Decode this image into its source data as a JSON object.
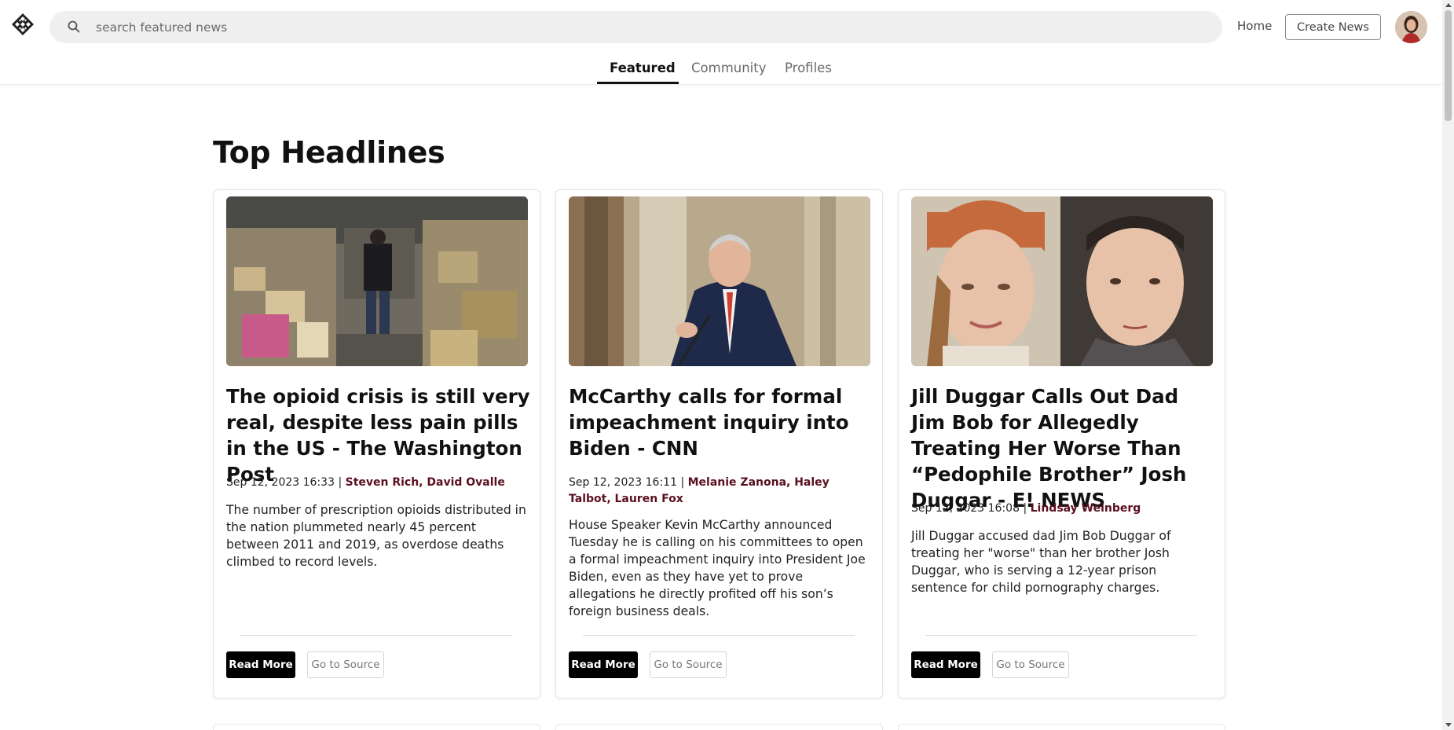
{
  "header": {
    "logo_icon": "diamond-lattice-logo-icon",
    "search_placeholder": "search featured news",
    "search_icon": "search-icon",
    "home_label": "Home",
    "create_label": "Create News"
  },
  "tabs": [
    {
      "label": "Featured",
      "active": true
    },
    {
      "label": "Community",
      "active": false
    },
    {
      "label": "Profiles",
      "active": false
    }
  ],
  "section_title": "Top Headlines",
  "articles": [
    {
      "title": "The opioid crisis is still very real, despite less pain pills in the US - The Washington Post",
      "date": "Sep 12, 2023 16:33",
      "separator": "|",
      "authors": "Steven Rich, David Ovalle",
      "description": "The number of prescription opioids distributed in the nation plummeted nearly 45 percent between 2011 and 2019, as overdose deaths climbed to record levels.",
      "read_more": "Read More",
      "go_to_source": "Go to Source"
    },
    {
      "title": "McCarthy calls for formal impeachment inquiry into Biden - CNN",
      "date": "Sep 12, 2023 16:11",
      "separator": "|",
      "authors": "Melanie Zanona, Haley Talbot, Lauren Fox",
      "description": "House Speaker Kevin McCarthy announced Tuesday he is calling on his committees to open a formal impeachment inquiry into President Joe Biden, even as they have yet to prove allegations he directly profited off his son’s foreign business deals.",
      "read_more": "Read More",
      "go_to_source": "Go to Source"
    },
    {
      "title": "Jill Duggar Calls Out Dad Jim Bob for Allegedly Treating Her Worse Than “Pedophile Brother” Josh Duggar - E! NEWS",
      "date": "Sep 12, 2023 16:08",
      "separator": "|",
      "authors": "Lindsay Weinberg",
      "description": "Jill Duggar accused dad Jim Bob Duggar of treating her \"worse\" than her brother Josh Duggar, who is serving a 12-year prison sentence for child pornography charges.",
      "read_more": "Read More",
      "go_to_source": "Go to Source"
    }
  ],
  "colors": {
    "author": "#5a1020",
    "primary_button": "#000000",
    "search_bg": "#efefef"
  }
}
